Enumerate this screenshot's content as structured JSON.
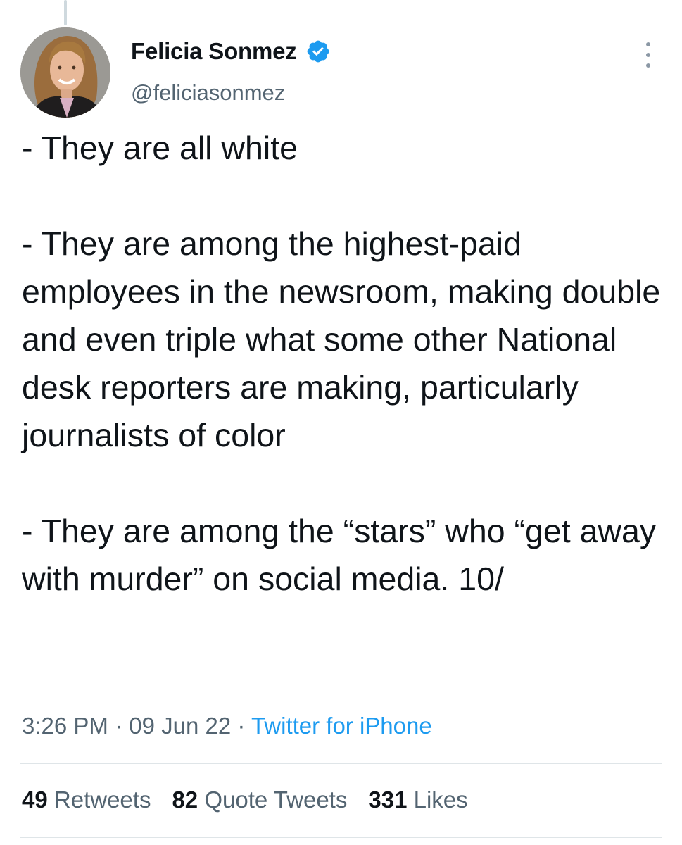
{
  "tweet": {
    "author": {
      "display_name": "Felicia Sonmez",
      "handle": "@feliciasonmez",
      "verified": true,
      "avatar_icon": "profile-photo"
    },
    "paragraphs": [
      "- They are all white",
      "- They are among the highest-paid employees in the newsroom, making double and even triple what some other National desk reporters are making, particularly journalists of color",
      "- They are among the “stars” who “get away with murder” on social media. 10/"
    ],
    "time": "3:26 PM",
    "separator": " · ",
    "date": "09 Jun 22",
    "source": "Twitter for iPhone",
    "stats": {
      "retweets_count": "49",
      "retweets_label": "Retweets",
      "quote_tweets_count": "82",
      "quote_tweets_label": "Quote Tweets",
      "likes_count": "331",
      "likes_label": "Likes"
    }
  },
  "colors": {
    "text": "#0f1419",
    "secondary": "#536471",
    "link": "#1d9bf0",
    "verified_badge": "#1d9bf0",
    "divider": "#dfe5e8"
  },
  "icons": {
    "verified": "verified-badge-icon",
    "more": "more-vertical-icon"
  }
}
